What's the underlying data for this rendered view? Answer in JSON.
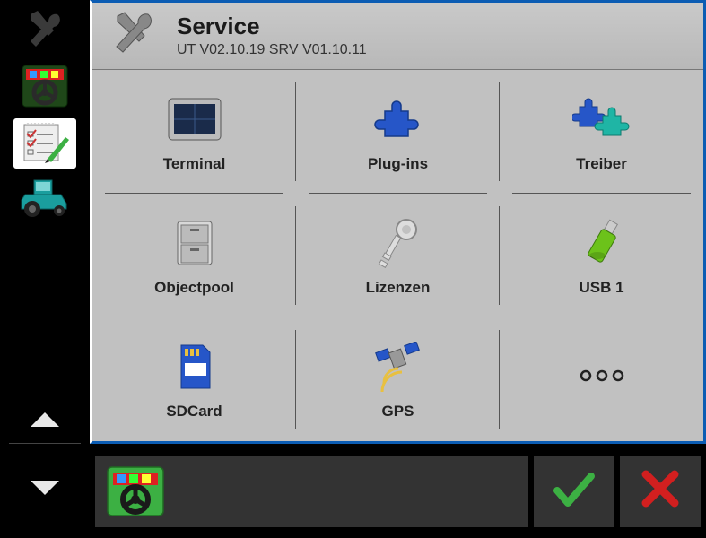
{
  "header": {
    "title": "Service",
    "subtitle": "UT V02.10.19  SRV V01.10.11"
  },
  "grid": [
    {
      "label": "Terminal",
      "icon": "terminal-icon"
    },
    {
      "label": "Plug-ins",
      "icon": "plugin-icon"
    },
    {
      "label": "Treiber",
      "icon": "driver-icon"
    },
    {
      "label": "Objectpool",
      "icon": "cabinet-icon"
    },
    {
      "label": "Lizenzen",
      "icon": "key-icon"
    },
    {
      "label": "USB 1",
      "icon": "usb-icon"
    },
    {
      "label": "SDCard",
      "icon": "sdcard-icon"
    },
    {
      "label": "GPS",
      "icon": "satellite-icon"
    },
    {
      "label": "",
      "icon": "more-icon"
    }
  ],
  "sidebar": {
    "items": [
      {
        "icon": "tools-icon"
      },
      {
        "icon": "steering-nav-icon"
      },
      {
        "icon": "checklist-icon"
      },
      {
        "icon": "tractor-icon"
      }
    ]
  }
}
